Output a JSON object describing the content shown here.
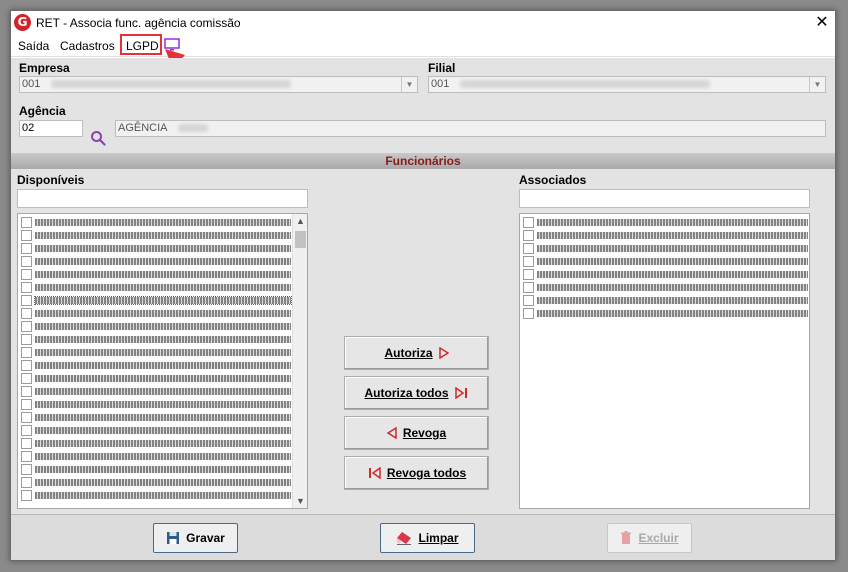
{
  "window": {
    "title": "RET - Associa func. agência comissão",
    "logo_letter": "G",
    "close_glyph": "✕"
  },
  "menu": {
    "items": [
      "Saída",
      "Cadastros",
      "LGPD"
    ],
    "highlight_color": "#e53238",
    "monitor_icon": "monitor-icon"
  },
  "form": {
    "empresa_label": "Empresa",
    "empresa_value": "001",
    "filial_label": "Filial",
    "filial_value": "001",
    "agencia_label": "Agência",
    "agencia_code": "02",
    "agencia_name": "AGÊNCIA"
  },
  "section": {
    "title": "Funcionários",
    "title_color": "#8b1a1a"
  },
  "disponiveis": {
    "label": "Disponíveis",
    "filter_value": "",
    "row_count": 22,
    "selected_row": 6
  },
  "associados": {
    "label": "Associados",
    "filter_value": "",
    "row_count": 8
  },
  "actions": {
    "autoriza": "Autoriza",
    "autoriza_todos": "Autoriza todos",
    "revoga": "Revoga",
    "revoga_todos": "Revoga todos",
    "arrow_color": "#d12a2a"
  },
  "footer": {
    "gravar": "Gravar",
    "limpar": "Limpar",
    "excluir": "Excluir"
  }
}
